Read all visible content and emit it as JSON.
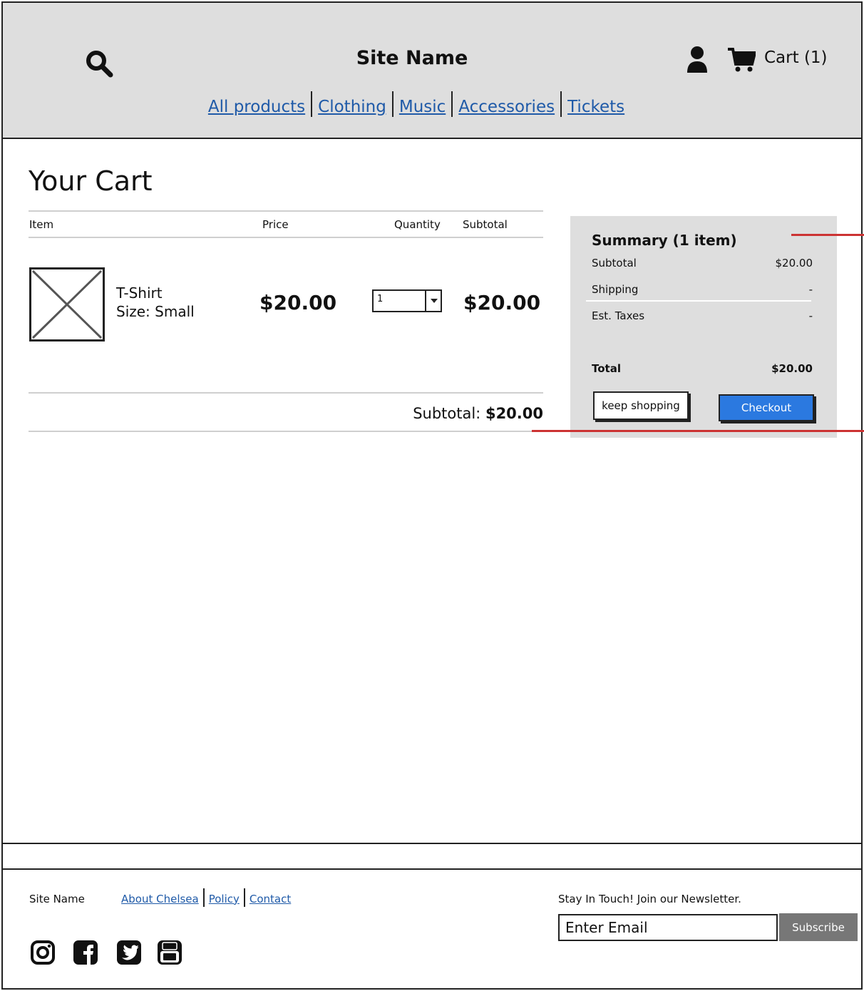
{
  "header": {
    "site_name": "Site Name",
    "cart_label": "Cart (1)",
    "nav": [
      "All products",
      "Clothing",
      "Music",
      "Accessories",
      "Tickets"
    ]
  },
  "main": {
    "title": "Your Cart",
    "columns": {
      "item": "Item",
      "price": "Price",
      "quantity": "Quantity",
      "subtotal": "Subtotal"
    },
    "item": {
      "name": "T-Shirt",
      "size": "Size: Small",
      "price": "$20.00",
      "quantity": "1",
      "subtotal": "$20.00"
    },
    "subtotal_label": "Subtotal:",
    "subtotal_value": "$20.00"
  },
  "summary": {
    "title": "Summary (1 item)",
    "subtotal_label": "Subtotal",
    "subtotal_value": "$20.00",
    "shipping_label": "Shipping",
    "shipping_value": "-",
    "taxes_label": "Est. Taxes",
    "taxes_value": "-",
    "total_label": "Total",
    "total_value": "$20.00",
    "keep_shopping": "keep shopping",
    "checkout": "Checkout"
  },
  "footer": {
    "site_name": "Site Name",
    "links": [
      "About Chelsea",
      "Policy",
      "Contact"
    ],
    "newsletter_label": "Stay In Touch! Join our Newsletter.",
    "email_placeholder": "Enter Email",
    "subscribe": "Subscribe",
    "social_icons": [
      "instagram-icon",
      "facebook-icon",
      "twitter-icon",
      "youtube-icon"
    ]
  },
  "colors": {
    "header_bg": "#dedede",
    "link": "#1f5aa8",
    "checkout_bg": "#2b79e0",
    "annotation_red": "#cc3333",
    "subscribe_bg": "#777777"
  }
}
